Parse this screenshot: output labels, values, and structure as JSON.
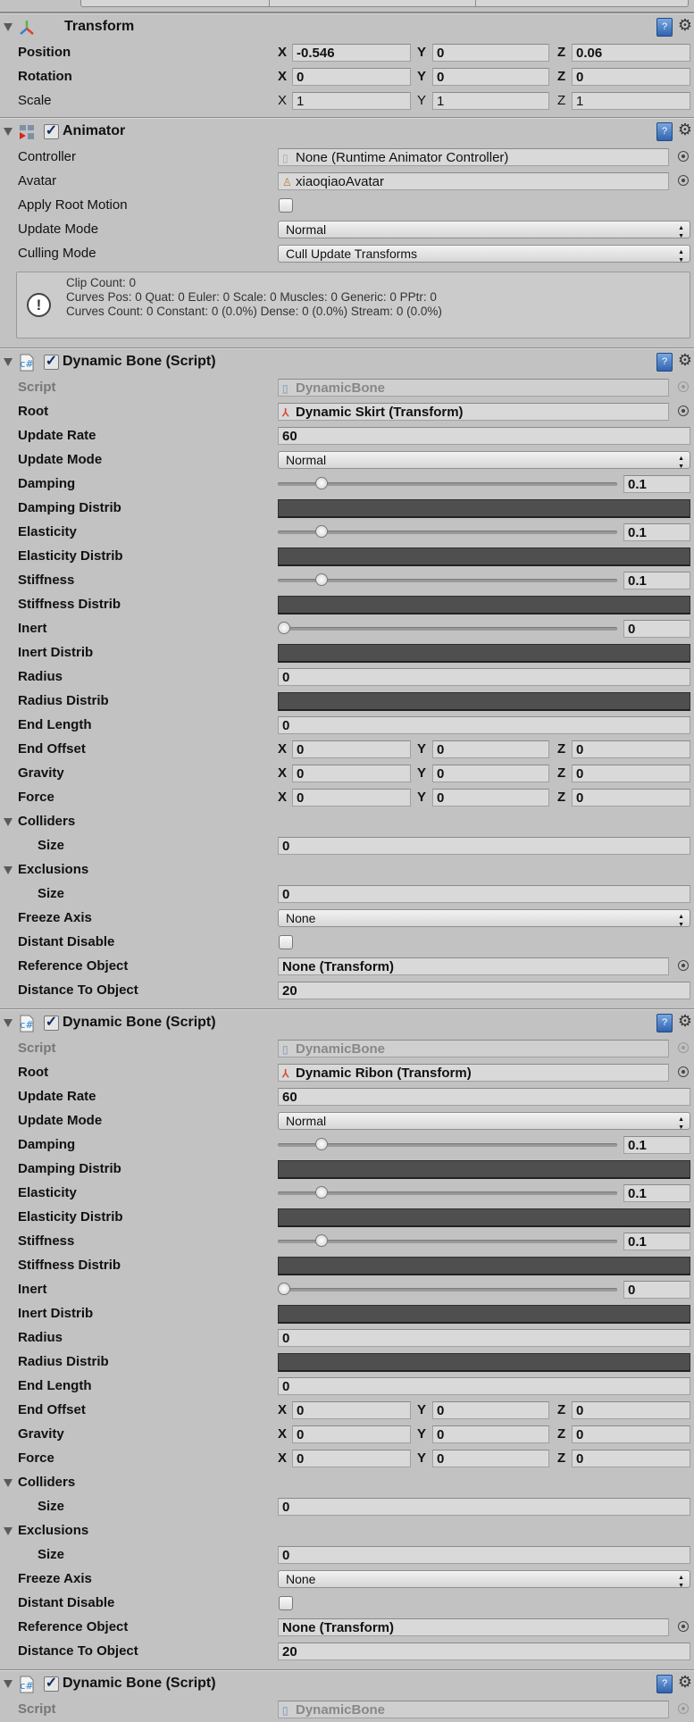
{
  "colors": {
    "background": "#c2c2c2",
    "field": "#d9d9d9",
    "curve_field": "#4f4f4f",
    "checkmark": "#0b2c66"
  },
  "transform": {
    "title": "Transform",
    "icon": "transform-axes-icon",
    "rows": [
      {
        "type": "vector3",
        "label": "Position",
        "bold": true,
        "x": "-0.546",
        "y": "0",
        "z": "0.06"
      },
      {
        "type": "vector3",
        "label": "Rotation",
        "bold": true,
        "x": "0",
        "y": "0",
        "z": "0"
      },
      {
        "type": "vector3",
        "label": "Scale",
        "bold": false,
        "x": "1",
        "y": "1",
        "z": "1"
      }
    ]
  },
  "animator": {
    "title": "Animator",
    "icon": "animator-icon",
    "enabled": true,
    "rows": [
      {
        "type": "object",
        "label": "Controller",
        "value": "None (Runtime Animator Controller)",
        "icon": "file-icon"
      },
      {
        "type": "object",
        "label": "Avatar",
        "value": "xiaoqiaoAvatar",
        "icon": "avatar-icon"
      },
      {
        "type": "checkbox",
        "label": "Apply Root Motion",
        "checked": false
      },
      {
        "type": "dropdown",
        "label": "Update Mode",
        "value": "Normal"
      },
      {
        "type": "dropdown",
        "label": "Culling Mode",
        "value": "Cull Update Transforms"
      }
    ],
    "info": [
      "Clip Count: 0",
      "Curves Pos: 0 Quat: 0 Euler: 0 Scale: 0 Muscles: 0 Generic: 0 PPtr: 0",
      "Curves Count: 0 Constant: 0 (0.0%) Dense: 0 (0.0%) Stream: 0 (0.0%)"
    ]
  },
  "dynamic_bones": [
    {
      "title": "Dynamic Bone (Script)",
      "enabled": true,
      "rows": [
        {
          "type": "script",
          "label": "Script",
          "value": "DynamicBone"
        },
        {
          "type": "object",
          "label": "Root",
          "value": "Dynamic Skirt (Transform)",
          "icon": "transform-icon",
          "bold": true
        },
        {
          "type": "number",
          "label": "Update Rate",
          "value": "60"
        },
        {
          "type": "dropdown",
          "label": "Update Mode",
          "value": "Normal"
        },
        {
          "type": "slider",
          "label": "Damping",
          "value": "0.1",
          "fraction": 0.1
        },
        {
          "type": "curve",
          "label": "Damping Distrib"
        },
        {
          "type": "slider",
          "label": "Elasticity",
          "value": "0.1",
          "fraction": 0.1
        },
        {
          "type": "curve",
          "label": "Elasticity Distrib"
        },
        {
          "type": "slider",
          "label": "Stiffness",
          "value": "0.1",
          "fraction": 0.1
        },
        {
          "type": "curve",
          "label": "Stiffness Distrib"
        },
        {
          "type": "slider",
          "label": "Inert",
          "value": "0",
          "fraction": 0
        },
        {
          "type": "curve",
          "label": "Inert Distrib"
        },
        {
          "type": "number",
          "label": "Radius",
          "value": "0"
        },
        {
          "type": "curve",
          "label": "Radius Distrib"
        },
        {
          "type": "number",
          "label": "End Length",
          "value": "0"
        },
        {
          "type": "vector3",
          "label": "End Offset",
          "bold": true,
          "x": "0",
          "y": "0",
          "z": "0"
        },
        {
          "type": "vector3",
          "label": "Gravity",
          "bold": true,
          "x": "0",
          "y": "0",
          "z": "0"
        },
        {
          "type": "vector3",
          "label": "Force",
          "bold": true,
          "x": "0",
          "y": "0",
          "z": "0"
        },
        {
          "type": "foldout",
          "label": "Colliders"
        },
        {
          "type": "number",
          "label": "Size",
          "value": "0",
          "indent": true
        },
        {
          "type": "foldout",
          "label": "Exclusions"
        },
        {
          "type": "number",
          "label": "Size",
          "value": "0",
          "indent": true
        },
        {
          "type": "dropdown",
          "label": "Freeze Axis",
          "value": "None"
        },
        {
          "type": "checkbox",
          "label": "Distant Disable",
          "checked": false
        },
        {
          "type": "object",
          "label": "Reference Object",
          "value": "None (Transform)",
          "bold": true
        },
        {
          "type": "number",
          "label": "Distance To Object",
          "value": "20"
        }
      ]
    },
    {
      "title": "Dynamic Bone (Script)",
      "enabled": true,
      "rows": [
        {
          "type": "script",
          "label": "Script",
          "value": "DynamicBone"
        },
        {
          "type": "object",
          "label": "Root",
          "value": "Dynamic Ribon (Transform)",
          "icon": "transform-icon",
          "bold": true
        },
        {
          "type": "number",
          "label": "Update Rate",
          "value": "60"
        },
        {
          "type": "dropdown",
          "label": "Update Mode",
          "value": "Normal"
        },
        {
          "type": "slider",
          "label": "Damping",
          "value": "0.1",
          "fraction": 0.1
        },
        {
          "type": "curve",
          "label": "Damping Distrib"
        },
        {
          "type": "slider",
          "label": "Elasticity",
          "value": "0.1",
          "fraction": 0.1
        },
        {
          "type": "curve",
          "label": "Elasticity Distrib"
        },
        {
          "type": "slider",
          "label": "Stiffness",
          "value": "0.1",
          "fraction": 0.1
        },
        {
          "type": "curve",
          "label": "Stiffness Distrib"
        },
        {
          "type": "slider",
          "label": "Inert",
          "value": "0",
          "fraction": 0
        },
        {
          "type": "curve",
          "label": "Inert Distrib"
        },
        {
          "type": "number",
          "label": "Radius",
          "value": "0"
        },
        {
          "type": "curve",
          "label": "Radius Distrib"
        },
        {
          "type": "number",
          "label": "End Length",
          "value": "0"
        },
        {
          "type": "vector3",
          "label": "End Offset",
          "bold": true,
          "x": "0",
          "y": "0",
          "z": "0"
        },
        {
          "type": "vector3",
          "label": "Gravity",
          "bold": true,
          "x": "0",
          "y": "0",
          "z": "0"
        },
        {
          "type": "vector3",
          "label": "Force",
          "bold": true,
          "x": "0",
          "y": "0",
          "z": "0"
        },
        {
          "type": "foldout",
          "label": "Colliders"
        },
        {
          "type": "number",
          "label": "Size",
          "value": "0",
          "indent": true
        },
        {
          "type": "foldout",
          "label": "Exclusions"
        },
        {
          "type": "number",
          "label": "Size",
          "value": "0",
          "indent": true
        },
        {
          "type": "dropdown",
          "label": "Freeze Axis",
          "value": "None"
        },
        {
          "type": "checkbox",
          "label": "Distant Disable",
          "checked": false
        },
        {
          "type": "object",
          "label": "Reference Object",
          "value": "None (Transform)",
          "bold": true
        },
        {
          "type": "number",
          "label": "Distance To Object",
          "value": "20"
        }
      ]
    },
    {
      "title": "Dynamic Bone (Script)",
      "enabled": true,
      "rows": [
        {
          "type": "script",
          "label": "Script",
          "value": "DynamicBone"
        }
      ]
    }
  ]
}
